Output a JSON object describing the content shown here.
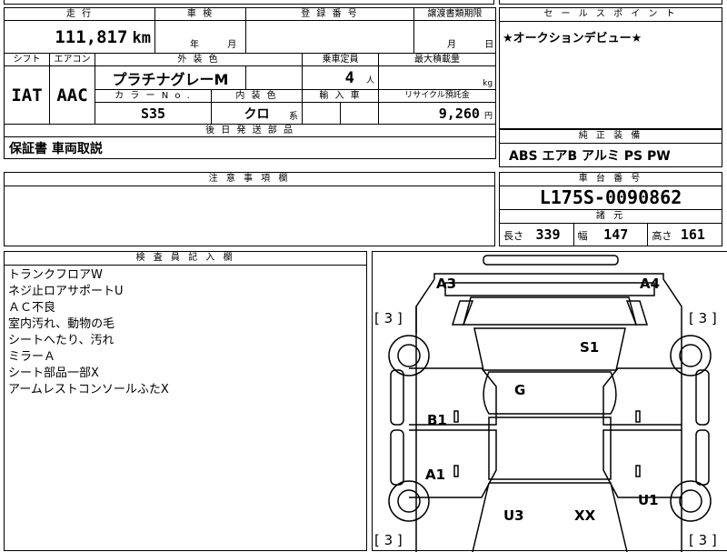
{
  "header_partial": "",
  "row1": {
    "mileage_label": "走 行",
    "mileage_value": "111,817",
    "mileage_unit": "km",
    "inspection_label": "車 検",
    "inspection_year": "年",
    "inspection_month": "月",
    "registration_label": "登 録 番 号",
    "transfer_label": "譲渡書類期限",
    "transfer_month": "月",
    "transfer_day": "日"
  },
  "row2": {
    "shift_label": "シフト",
    "shift_value": "IAT",
    "ac_label": "エアコン",
    "ac_value": "AAC",
    "exterior_label": "外 装 色",
    "exterior_value": "プラチナグレーM",
    "capacity_label": "乗車定員",
    "capacity_value": "4",
    "capacity_unit": "人",
    "load_label": "最大積載量",
    "load_unit": "kg",
    "color_no_label": "カ ラ ー N o .",
    "color_no_value": "S35",
    "interior_label": "内 装 色",
    "interior_value": "クロ",
    "interior_suffix": "系",
    "import_label": "輸 入 車",
    "recycle_label": "リサイクル預託金",
    "recycle_value": "9,260",
    "recycle_unit": "円"
  },
  "later_parts": {
    "label": "後 日 発 送 部 品",
    "value": "保証書 車両取説"
  },
  "notes": {
    "label": "注 意 事 項 欄",
    "value": ""
  },
  "sales_point": {
    "label": "セ ー ル ス ポ イ ン ト",
    "value": "★オークションデビュー★"
  },
  "equipment": {
    "label": "純 正 装 備",
    "value": "ABS エアB アルミ PS PW"
  },
  "chassis": {
    "label": "車 台 番 号",
    "value": "L175S-0090862"
  },
  "specs": {
    "label": "諸 元",
    "length_label": "長さ",
    "length_value": "339",
    "width_label": "幅",
    "width_value": "147",
    "height_label": "高さ",
    "height_value": "161"
  },
  "inspector": {
    "label": "検 査 員 記 入 欄",
    "lines": [
      "トランクフロアW",
      "ネジ止ロアサポートU",
      "ＡＣ不良",
      "室内汚れ、動物の毛",
      "シートへたり、汚れ",
      "ミラーＡ",
      "シート部品一部X",
      "アームレストコンソールふたX"
    ]
  },
  "diagram": {
    "marks": {
      "a3": "A3",
      "a4": "A4",
      "s1": "S1",
      "g": "G",
      "b1": "B1",
      "a1": "A1",
      "u1": "U1",
      "u3": "U3",
      "xx": "XX"
    },
    "tires": {
      "tl": "[ 3 ]",
      "tr": "[ 3 ]",
      "bl": "[ 3 ]",
      "br": "[ 3 ]"
    }
  }
}
